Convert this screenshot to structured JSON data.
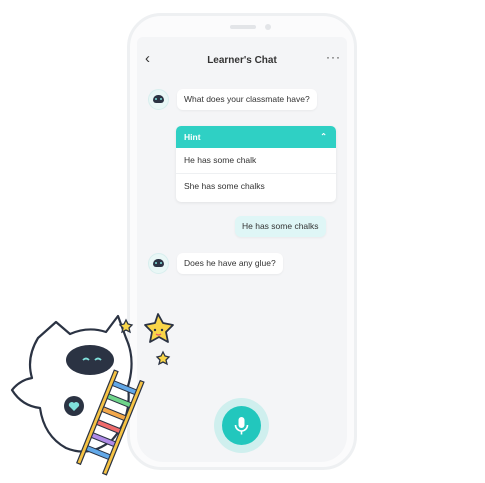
{
  "header": {
    "back_icon": "chevron-left-icon",
    "title": "Learner's Chat",
    "more_icon": "more-horizontal-icon"
  },
  "messages": [
    {
      "from": "bot",
      "text": "What does your classmate have?"
    },
    {
      "from": "user",
      "text": "He has some chalks"
    },
    {
      "from": "bot",
      "text": "Does he have any glue?"
    }
  ],
  "hint": {
    "label": "Hint",
    "expanded": true,
    "options": [
      "He has some chalk",
      "She has some chalks"
    ]
  },
  "mic_button": {
    "icon": "microphone-icon"
  },
  "colors": {
    "accent": "#2fd0c4",
    "user_bubble": "#dff6f6",
    "background": "#f4f5f7"
  }
}
